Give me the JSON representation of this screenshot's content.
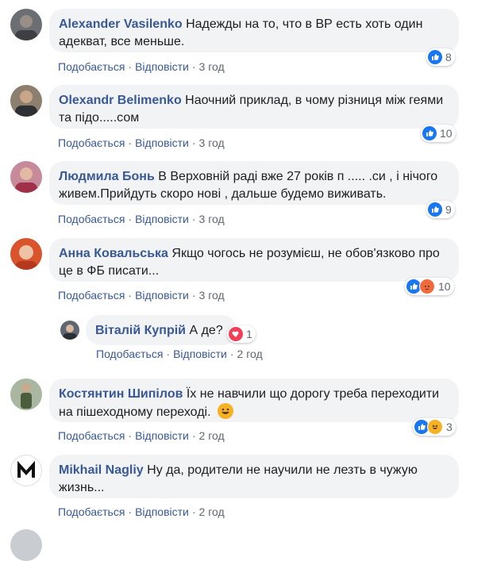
{
  "actions": {
    "like": "Подобається",
    "reply": "Відповісти",
    "sep": "·"
  },
  "comments": [
    {
      "author": "Alexander Vasilenko",
      "text": "Надежды на то, что в ВР есть хоть один адекват, все меньше.",
      "time": "3 год",
      "reactions": "8"
    },
    {
      "author": "Olexandr Belimenko",
      "text": "Наочний приклад, в чому різниця між геями та підо.....сом",
      "time": "3 год",
      "reactions": "10"
    },
    {
      "author": "Людмила Бонь",
      "text": "В Верховній раді вже 27 років п ..... .си , і нічого живем.Прийдуть скоро нові , дальше будемо виживать.",
      "time": "3 год",
      "reactions": "9"
    },
    {
      "author": "Анна Ковальська",
      "text": "Якщо чогось не розумієш, не обов'язково про це в ФБ писати...",
      "time": "3 год",
      "reactions": "10"
    },
    {
      "author": "Віталій Купрій",
      "text": "А де?",
      "time": "2 год",
      "reactions": "1"
    },
    {
      "author": "Костянтин Шипілов",
      "text": "Їх не навчили що дорогу треба переходити на пішеходному переході.",
      "time": "2 год",
      "reactions": "3"
    },
    {
      "author": "Mikhail Nagliy",
      "text": "Ну да, родители не научили не лезть в чужую жизнь...",
      "time": "2 год"
    }
  ]
}
